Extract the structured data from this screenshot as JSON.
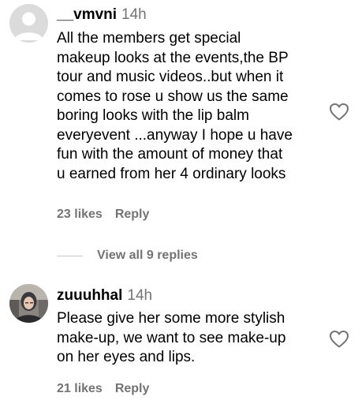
{
  "comments": [
    {
      "username": "__vmvni",
      "time": "14h",
      "lines": [
        "All the members get special",
        "makeup looks at the events,the BP",
        "tour and music videos..but when it",
        "comes to rose u show us the same",
        "boring looks with the lip balm",
        "everyevent ...anyway I hope u have",
        "fun with the amount of money that",
        "u earned from her 4 ordinary looks"
      ],
      "likes": "23 likes",
      "reply": "Reply",
      "avatar_icon": "default-profile-icon",
      "replies_label": "View all 9 replies"
    },
    {
      "username": "zuuuhhal",
      "time": "14h",
      "lines": [
        "Please give her some more stylish",
        "make-up, we want to see make-up",
        "on her eyes and lips."
      ],
      "likes": "21 likes",
      "reply": "Reply",
      "avatar_icon": "user-photo-avatar"
    }
  ],
  "colors": {
    "text": "#000000",
    "secondary": "#737373",
    "divider": "#c7c7c7",
    "avatar_placeholder": "#dbdbdb"
  }
}
